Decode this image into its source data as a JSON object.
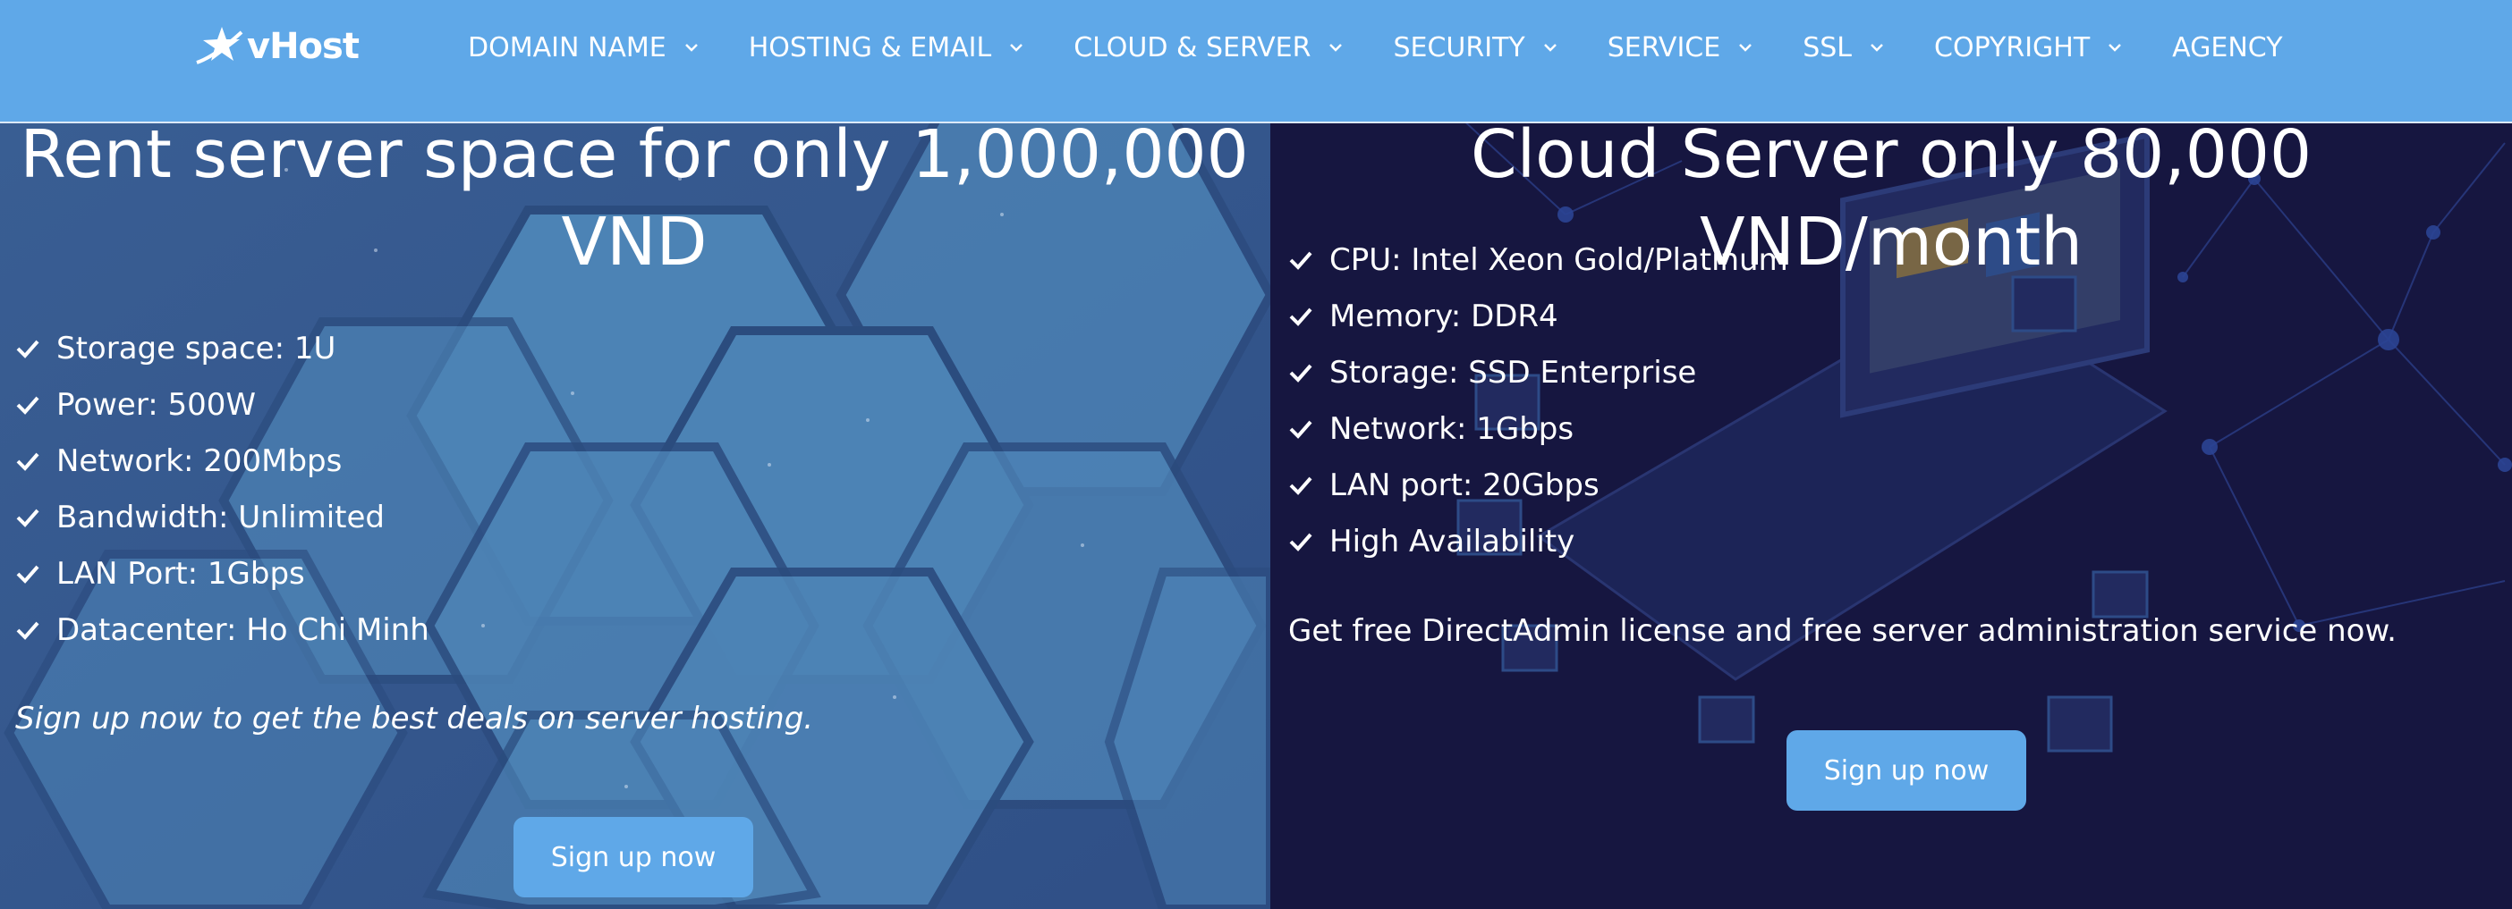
{
  "brand": {
    "name": "vHost",
    "logo_icon": "star-swoosh-icon"
  },
  "nav": {
    "items": [
      {
        "label": "DOMAIN NAME",
        "dropdown": true
      },
      {
        "label": "HOSTING & EMAIL",
        "dropdown": true
      },
      {
        "label": "CLOUD & SERVER",
        "dropdown": true
      },
      {
        "label": "SECURITY",
        "dropdown": true
      },
      {
        "label": "SERVICE",
        "dropdown": true
      },
      {
        "label": "SSL",
        "dropdown": true
      },
      {
        "label": "COPYRIGHT",
        "dropdown": true
      },
      {
        "label": "AGENCY",
        "dropdown": false
      }
    ]
  },
  "left_panel": {
    "title_line1": "Rent server space for only 1,000,000",
    "title_line2": "VND",
    "features": [
      "Storage space: 1U",
      "Power: 500W",
      "Network: 200Mbps",
      "Bandwidth: Unlimited",
      "LAN Port: 1Gbps",
      "Datacenter: Ho Chi Minh"
    ],
    "note": "Sign up now to get the best deals on server hosting.",
    "button_label": "Sign up now"
  },
  "right_panel": {
    "title": "Cloud Server only 80,000 VND/month",
    "features": [
      "CPU: Intel Xeon Gold/Platinum",
      "Memory: DDR4",
      "Storage: SSD Enterprise",
      "Network: 1Gbps",
      "LAN port: 20Gbps",
      "High Availability"
    ],
    "note": "Get free DirectAdmin license and free server administration service now.",
    "button_label": "Sign up now"
  },
  "colors": {
    "nav_bg": "#5fa8e8",
    "left_bg": "#3d6a9c",
    "right_bg": "#161640",
    "button_bg": "#5fa8e8",
    "text": "#ffffff"
  }
}
